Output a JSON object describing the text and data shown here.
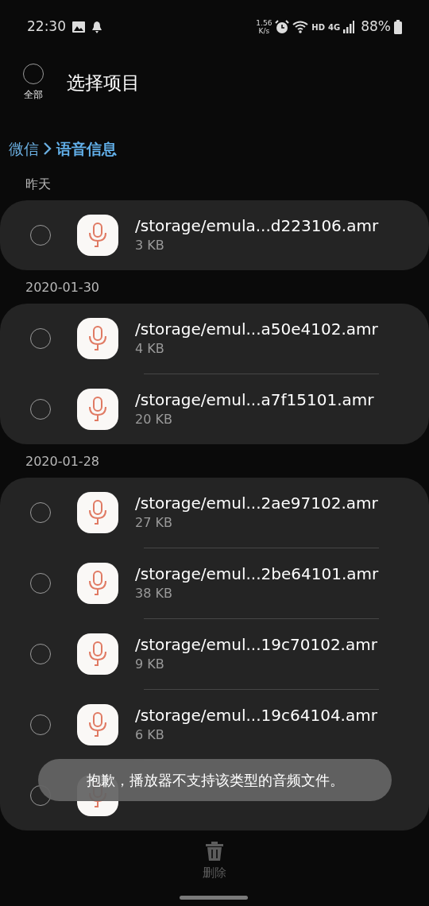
{
  "status_bar": {
    "time": "22:30",
    "net_speed_value": "1.56",
    "net_speed_unit": "K/s",
    "hd": "HD",
    "network": "4G",
    "battery": "88%"
  },
  "header": {
    "select_all": {
      "label": "全部",
      "selected": false
    },
    "title": "选择项目"
  },
  "breadcrumb": [
    {
      "label": "微信",
      "current": false
    },
    {
      "label": "语音信息",
      "current": true
    }
  ],
  "groups": [
    {
      "label": "昨天",
      "files": [
        {
          "name": "/storage/emula...d223106.amr",
          "size": "3 KB",
          "selected": false
        }
      ]
    },
    {
      "label": "2020-01-30",
      "files": [
        {
          "name": "/storage/emul...a50e4102.amr",
          "size": "4 KB",
          "selected": false
        },
        {
          "name": "/storage/emul...a7f15101.amr",
          "size": "20 KB",
          "selected": false
        }
      ]
    },
    {
      "label": "2020-01-28",
      "files": [
        {
          "name": "/storage/emul...2ae97102.amr",
          "size": "27 KB",
          "selected": false
        },
        {
          "name": "/storage/emul...2be64101.amr",
          "size": "38 KB",
          "selected": false
        },
        {
          "name": "/storage/emul...19c70102.amr",
          "size": "9 KB",
          "selected": false
        },
        {
          "name": "/storage/emul...19c64104.amr",
          "size": "6 KB",
          "selected": false
        },
        {
          "selected": false
        }
      ]
    }
  ],
  "toast": "抱歉，播放器不支持该类型的音频文件。",
  "bottom_bar": {
    "delete": {
      "label": "删除",
      "disabled": true
    }
  }
}
